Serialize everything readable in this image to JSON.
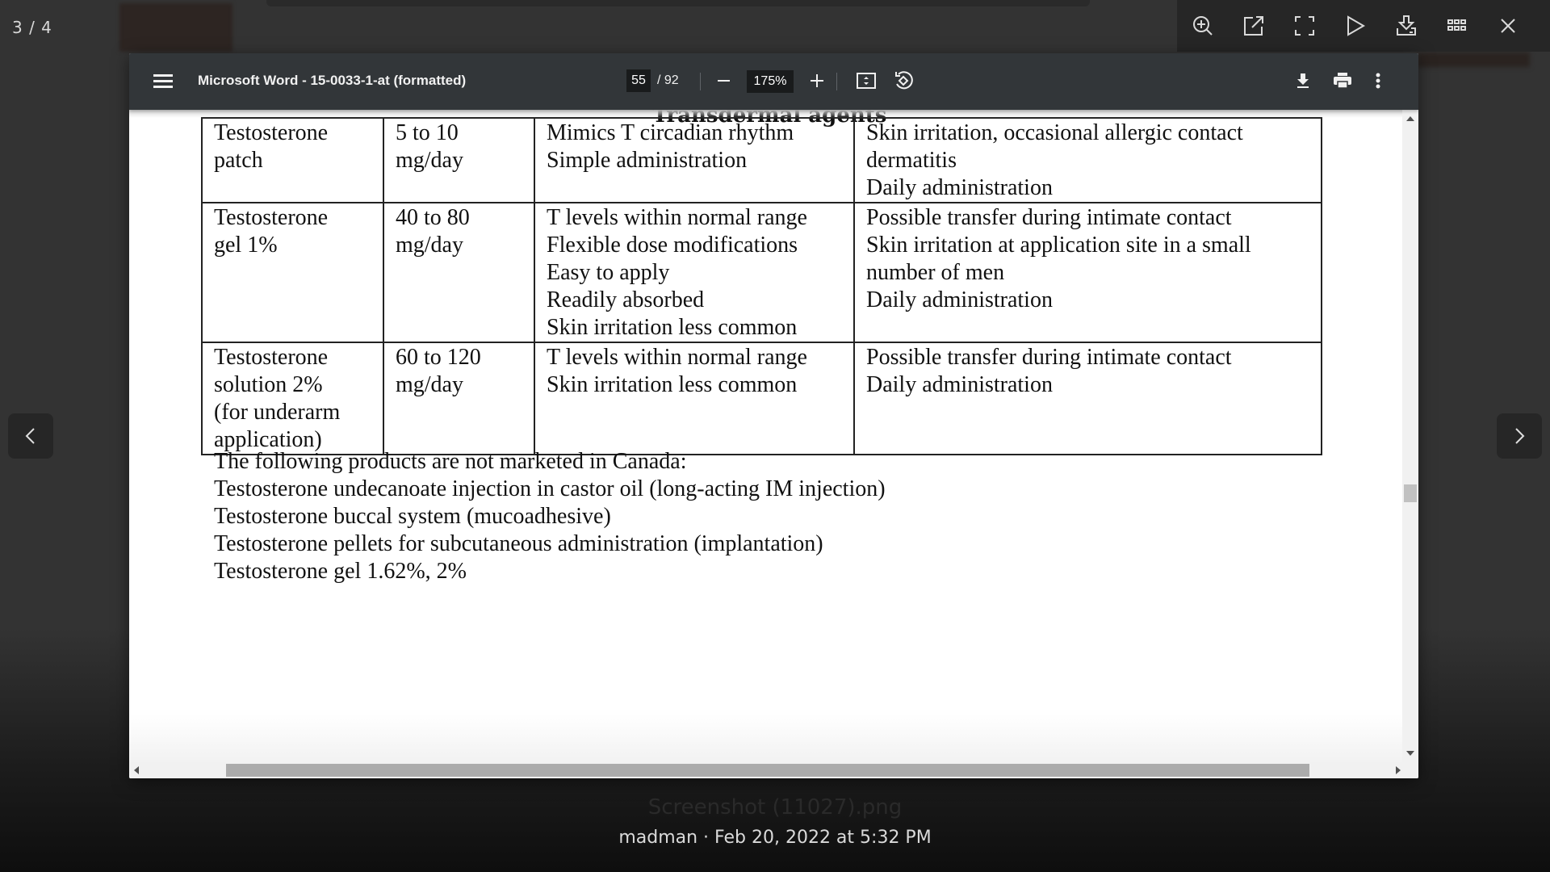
{
  "photo_viewer": {
    "counter": "3 / 4",
    "actions": [
      {
        "name": "zoom-in",
        "icon": "zoom-in-icon"
      },
      {
        "name": "open-external",
        "icon": "open-external-icon"
      },
      {
        "name": "fullscreen",
        "icon": "fullscreen-icon"
      },
      {
        "name": "slideshow",
        "icon": "play-icon"
      },
      {
        "name": "download",
        "icon": "download-icon"
      },
      {
        "name": "gallery",
        "icon": "grid-icon"
      },
      {
        "name": "close",
        "icon": "close-icon"
      }
    ],
    "filename": "Screenshot (11027).png",
    "meta": "madman · Feb 20, 2022 at 5:32 PM"
  },
  "pdf_viewer": {
    "title": "Microsoft Word - 15-0033-1-at (formatted)",
    "page_current": "55",
    "page_total": "/ 92",
    "zoom": "175%",
    "scroll_vertical_fraction": 0.59
  },
  "document": {
    "section_heading": "Transdermal agents",
    "rows": [
      {
        "product": [
          "Testosterone",
          "patch"
        ],
        "dose": [
          "5 to 10",
          "mg/day"
        ],
        "advantages": [
          "Mimics T circadian rhythm",
          "Simple administration"
        ],
        "disadvantages": [
          "Skin irritation, occasional allergic contact",
          "dermatitis",
          "Daily administration"
        ]
      },
      {
        "product": [
          "Testosterone",
          "gel 1%"
        ],
        "dose": [
          "40 to 80",
          "mg/day"
        ],
        "advantages": [
          "T levels within normal range",
          "Flexible dose modifications",
          "Easy to apply",
          "Readily absorbed",
          "Skin irritation less common"
        ],
        "disadvantages": [
          "Possible transfer during intimate contact",
          "Skin irritation at application site in a small",
          "number of men",
          "Daily administration"
        ]
      },
      {
        "product": [
          "Testosterone",
          "solution 2%",
          "(for underarm",
          "application)"
        ],
        "dose": [
          "60 to 120",
          "mg/day"
        ],
        "advantages": [
          "T levels within normal range",
          "Skin irritation less common"
        ],
        "disadvantages": [
          "Possible transfer during intimate contact",
          "Daily administration"
        ]
      }
    ],
    "notes": [
      "The following products are not marketed in Canada:",
      "Testosterone undecanoate injection in castor oil (long-acting IM injection)",
      "Testosterone buccal system (mucoadhesive)",
      "Testosterone pellets for subcutaneous administration (implantation)",
      "Testosterone gel 1.62%, 2%"
    ]
  }
}
